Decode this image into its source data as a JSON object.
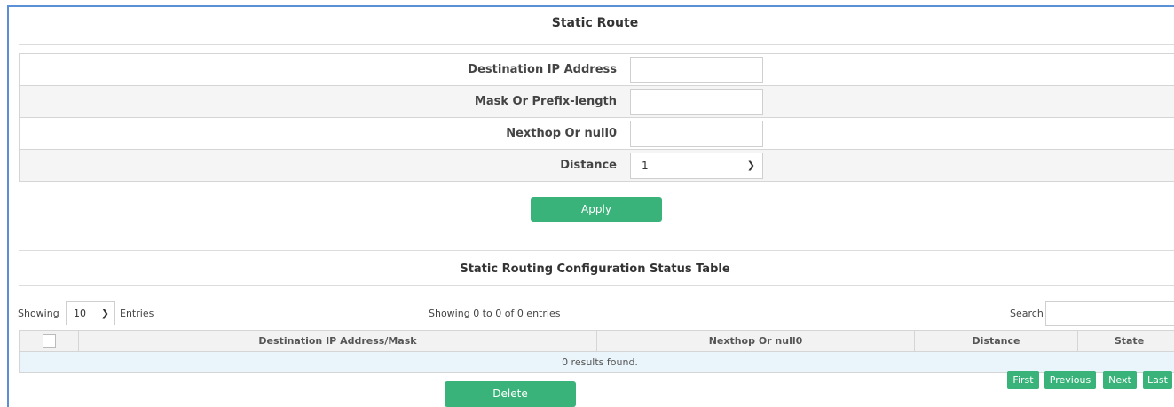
{
  "title": "Static Route",
  "form": {
    "fields": [
      {
        "label": "Destination IP Address",
        "value": ""
      },
      {
        "label": "Mask Or Prefix-length",
        "value": ""
      },
      {
        "label": "Nexthop Or null0",
        "value": ""
      }
    ],
    "distance": {
      "label": "Distance",
      "value": "1"
    },
    "apply_label": "Apply"
  },
  "status": {
    "title": "Static Routing Configuration Status Table",
    "showing_label": "Showing",
    "entries_value": "10",
    "entries_label": "Entries",
    "info": "Showing 0 to 0 of 0 entries",
    "search_label": "Search",
    "search_value": "",
    "columns": [
      "Destination IP Address/Mask",
      "Nexthop Or null0",
      "Distance",
      "State"
    ],
    "empty_text": "0 results found.",
    "delete_label": "Delete",
    "pagination": [
      "First",
      "Previous",
      "Next",
      "Last"
    ]
  },
  "colors": {
    "accent": "#3ab37a",
    "frame": "#5b8fd6"
  }
}
